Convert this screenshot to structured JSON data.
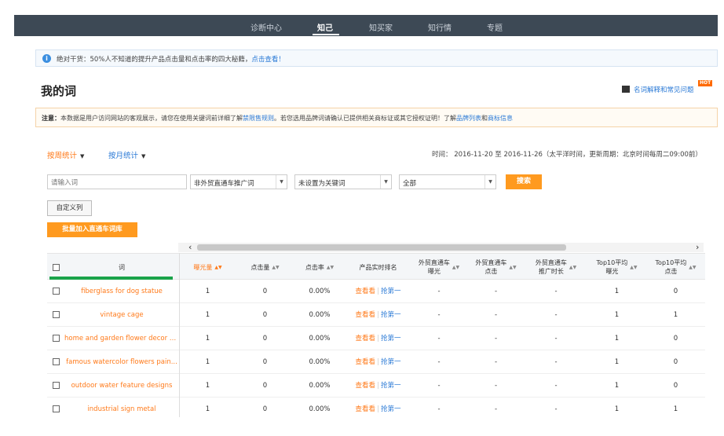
{
  "nav": {
    "items": [
      "诊断中心",
      "知己",
      "知买家",
      "知行情",
      "专题"
    ],
    "active": "知己"
  },
  "notice": {
    "text": "绝对干货：50%人不知道的提升产品点击量和点击率的四大秘籍，",
    "link": "点击查看！"
  },
  "page_title": "我的词",
  "help_link": "名词解释和常见问题",
  "hot_badge": "HOT",
  "warning": {
    "label": "注意：",
    "text1": "本数据是用户访问网站的客观展示，请您在使用关键词前详细了解",
    "link1": "禁限售规则",
    "text2": "。若您选用品牌词请确认已提供相关商标证或其它授权证明！了解",
    "link2": "品牌列表",
    "text3": "和",
    "link3": "商标信息"
  },
  "period_tabs": {
    "week": "按周统计",
    "month": "按月统计"
  },
  "time_text": "时间：  2016-11-20 至 2016-11-26（太平洋时间，更新周期：北京时间每周二09:00前）",
  "filters": {
    "search_placeholder": "请输入词",
    "select1": "非外贸直通车推广词",
    "select2": "未设置为关键词",
    "select3": "全部",
    "search_button": "搜索"
  },
  "buttons": {
    "custom_columns": "自定义列",
    "batch_add": "批量加入直通车词库"
  },
  "table": {
    "headers": {
      "keyword": "词",
      "impressions": "曝光量",
      "clicks": "点击量",
      "ctr": "点击率",
      "realtime_rank": "产品实时排名",
      "p4p_impressions_l1": "外贸直通车",
      "p4p_impressions_l2": "曝光",
      "p4p_clicks_l1": "外贸直通车",
      "p4p_clicks_l2": "点击",
      "p4p_duration_l1": "外贸直通车",
      "p4p_duration_l2": "推广时长",
      "top10_imp_l1": "Top10平均",
      "top10_imp_l2": "曝光",
      "top10_clk_l1": "Top10平均",
      "top10_clk_l2": "点击"
    },
    "action_view": "查看看",
    "action_grab": "抢第一",
    "rows": [
      {
        "keyword": "fiberglass for dog statue",
        "impressions": "1",
        "clicks": "0",
        "ctr": "0.00%",
        "p4p_imp": "-",
        "p4p_clk": "-",
        "p4p_dur": "-",
        "top10_imp": "1",
        "top10_clk": "0"
      },
      {
        "keyword": "vintage cage",
        "impressions": "1",
        "clicks": "0",
        "ctr": "0.00%",
        "p4p_imp": "-",
        "p4p_clk": "-",
        "p4p_dur": "-",
        "top10_imp": "1",
        "top10_clk": "1"
      },
      {
        "keyword": "home and garden flower decor p...",
        "impressions": "1",
        "clicks": "0",
        "ctr": "0.00%",
        "p4p_imp": "-",
        "p4p_clk": "-",
        "p4p_dur": "-",
        "top10_imp": "1",
        "top10_clk": "0"
      },
      {
        "keyword": "famous watercolor flowers pain...",
        "impressions": "1",
        "clicks": "0",
        "ctr": "0.00%",
        "p4p_imp": "-",
        "p4p_clk": "-",
        "p4p_dur": "-",
        "top10_imp": "1",
        "top10_clk": "0"
      },
      {
        "keyword": "outdoor water feature designs",
        "impressions": "1",
        "clicks": "0",
        "ctr": "0.00%",
        "p4p_imp": "-",
        "p4p_clk": "-",
        "p4p_dur": "-",
        "top10_imp": "1",
        "top10_clk": "0"
      },
      {
        "keyword": "industrial sign metal",
        "impressions": "1",
        "clicks": "0",
        "ctr": "0.00%",
        "p4p_imp": "-",
        "p4p_clk": "-",
        "p4p_dur": "-",
        "top10_imp": "1",
        "top10_clk": "1"
      }
    ]
  },
  "colors": {
    "accent_orange": "#ff9a1f",
    "link_blue": "#2b7ad6",
    "nav_bg": "#3d4955"
  }
}
